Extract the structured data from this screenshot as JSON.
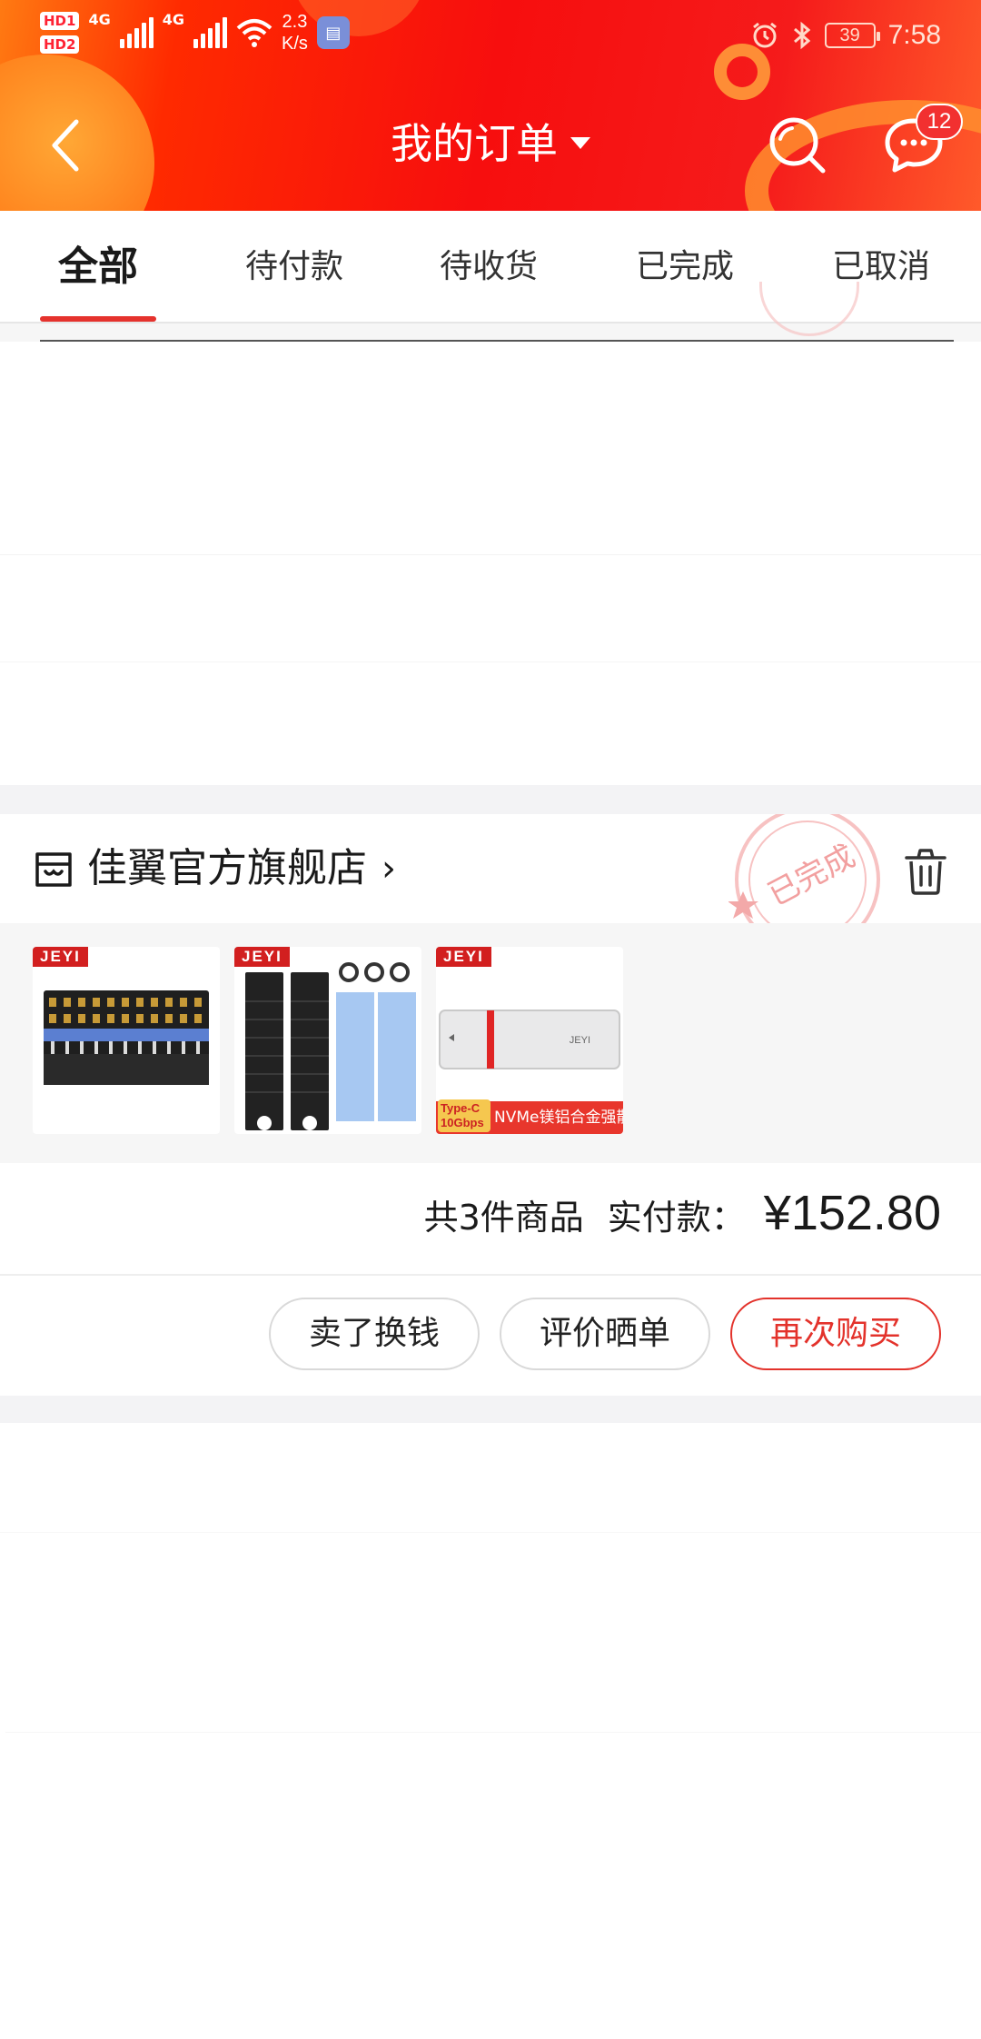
{
  "status_bar": {
    "hd1": "HD",
    "hd1_sub": "1",
    "hd2": "HD",
    "hd2_sub": "2",
    "net1": "4G",
    "net2": "4G",
    "speed_value": "2.3",
    "speed_unit": "K/s",
    "battery": "39",
    "time": "7:58"
  },
  "header": {
    "title": "我的订单",
    "message_badge": "12"
  },
  "tabs": [
    {
      "label": "全部",
      "active": true
    },
    {
      "label": "待付款",
      "active": false
    },
    {
      "label": "待收货",
      "active": false
    },
    {
      "label": "已完成",
      "active": false
    },
    {
      "label": "已取消",
      "active": false
    }
  ],
  "order": {
    "shop_name": "佳翼官方旗舰店",
    "shop_chevron": "›",
    "stamp_text": "已完成",
    "products": [
      {
        "brand": "JEYI"
      },
      {
        "brand": "JEYI"
      },
      {
        "brand": "JEYI",
        "chip_line1": "Type-C",
        "chip_line2": "10Gbps",
        "tag": "NVMe镁铝合金强散热",
        "device_label": "JEYI"
      }
    ],
    "count_text": "共3件商品",
    "paid_label": "实付款：",
    "price": "¥152.80",
    "buttons": {
      "sell": "卖了换钱",
      "review": "评价晒单",
      "rebuy": "再次购买"
    }
  },
  "colors": {
    "header_red": "#f70e0e",
    "accent_red": "#e3322b",
    "stamp_pink": "#f5b0b0"
  }
}
